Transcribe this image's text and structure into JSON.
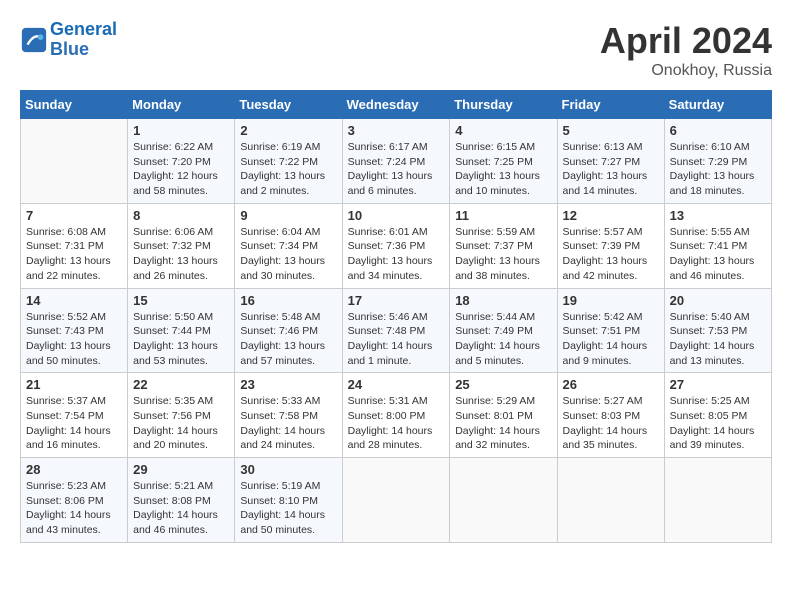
{
  "header": {
    "logo_line1": "General",
    "logo_line2": "Blue",
    "month": "April 2024",
    "location": "Onokhoy, Russia"
  },
  "days_of_week": [
    "Sunday",
    "Monday",
    "Tuesday",
    "Wednesday",
    "Thursday",
    "Friday",
    "Saturday"
  ],
  "weeks": [
    [
      {
        "day": "",
        "content": ""
      },
      {
        "day": "1",
        "content": "Sunrise: 6:22 AM\nSunset: 7:20 PM\nDaylight: 12 hours\nand 58 minutes."
      },
      {
        "day": "2",
        "content": "Sunrise: 6:19 AM\nSunset: 7:22 PM\nDaylight: 13 hours\nand 2 minutes."
      },
      {
        "day": "3",
        "content": "Sunrise: 6:17 AM\nSunset: 7:24 PM\nDaylight: 13 hours\nand 6 minutes."
      },
      {
        "day": "4",
        "content": "Sunrise: 6:15 AM\nSunset: 7:25 PM\nDaylight: 13 hours\nand 10 minutes."
      },
      {
        "day": "5",
        "content": "Sunrise: 6:13 AM\nSunset: 7:27 PM\nDaylight: 13 hours\nand 14 minutes."
      },
      {
        "day": "6",
        "content": "Sunrise: 6:10 AM\nSunset: 7:29 PM\nDaylight: 13 hours\nand 18 minutes."
      }
    ],
    [
      {
        "day": "7",
        "content": "Sunrise: 6:08 AM\nSunset: 7:31 PM\nDaylight: 13 hours\nand 22 minutes."
      },
      {
        "day": "8",
        "content": "Sunrise: 6:06 AM\nSunset: 7:32 PM\nDaylight: 13 hours\nand 26 minutes."
      },
      {
        "day": "9",
        "content": "Sunrise: 6:04 AM\nSunset: 7:34 PM\nDaylight: 13 hours\nand 30 minutes."
      },
      {
        "day": "10",
        "content": "Sunrise: 6:01 AM\nSunset: 7:36 PM\nDaylight: 13 hours\nand 34 minutes."
      },
      {
        "day": "11",
        "content": "Sunrise: 5:59 AM\nSunset: 7:37 PM\nDaylight: 13 hours\nand 38 minutes."
      },
      {
        "day": "12",
        "content": "Sunrise: 5:57 AM\nSunset: 7:39 PM\nDaylight: 13 hours\nand 42 minutes."
      },
      {
        "day": "13",
        "content": "Sunrise: 5:55 AM\nSunset: 7:41 PM\nDaylight: 13 hours\nand 46 minutes."
      }
    ],
    [
      {
        "day": "14",
        "content": "Sunrise: 5:52 AM\nSunset: 7:43 PM\nDaylight: 13 hours\nand 50 minutes."
      },
      {
        "day": "15",
        "content": "Sunrise: 5:50 AM\nSunset: 7:44 PM\nDaylight: 13 hours\nand 53 minutes."
      },
      {
        "day": "16",
        "content": "Sunrise: 5:48 AM\nSunset: 7:46 PM\nDaylight: 13 hours\nand 57 minutes."
      },
      {
        "day": "17",
        "content": "Sunrise: 5:46 AM\nSunset: 7:48 PM\nDaylight: 14 hours\nand 1 minute."
      },
      {
        "day": "18",
        "content": "Sunrise: 5:44 AM\nSunset: 7:49 PM\nDaylight: 14 hours\nand 5 minutes."
      },
      {
        "day": "19",
        "content": "Sunrise: 5:42 AM\nSunset: 7:51 PM\nDaylight: 14 hours\nand 9 minutes."
      },
      {
        "day": "20",
        "content": "Sunrise: 5:40 AM\nSunset: 7:53 PM\nDaylight: 14 hours\nand 13 minutes."
      }
    ],
    [
      {
        "day": "21",
        "content": "Sunrise: 5:37 AM\nSunset: 7:54 PM\nDaylight: 14 hours\nand 16 minutes."
      },
      {
        "day": "22",
        "content": "Sunrise: 5:35 AM\nSunset: 7:56 PM\nDaylight: 14 hours\nand 20 minutes."
      },
      {
        "day": "23",
        "content": "Sunrise: 5:33 AM\nSunset: 7:58 PM\nDaylight: 14 hours\nand 24 minutes."
      },
      {
        "day": "24",
        "content": "Sunrise: 5:31 AM\nSunset: 8:00 PM\nDaylight: 14 hours\nand 28 minutes."
      },
      {
        "day": "25",
        "content": "Sunrise: 5:29 AM\nSunset: 8:01 PM\nDaylight: 14 hours\nand 32 minutes."
      },
      {
        "day": "26",
        "content": "Sunrise: 5:27 AM\nSunset: 8:03 PM\nDaylight: 14 hours\nand 35 minutes."
      },
      {
        "day": "27",
        "content": "Sunrise: 5:25 AM\nSunset: 8:05 PM\nDaylight: 14 hours\nand 39 minutes."
      }
    ],
    [
      {
        "day": "28",
        "content": "Sunrise: 5:23 AM\nSunset: 8:06 PM\nDaylight: 14 hours\nand 43 minutes."
      },
      {
        "day": "29",
        "content": "Sunrise: 5:21 AM\nSunset: 8:08 PM\nDaylight: 14 hours\nand 46 minutes."
      },
      {
        "day": "30",
        "content": "Sunrise: 5:19 AM\nSunset: 8:10 PM\nDaylight: 14 hours\nand 50 minutes."
      },
      {
        "day": "",
        "content": ""
      },
      {
        "day": "",
        "content": ""
      },
      {
        "day": "",
        "content": ""
      },
      {
        "day": "",
        "content": ""
      }
    ]
  ]
}
